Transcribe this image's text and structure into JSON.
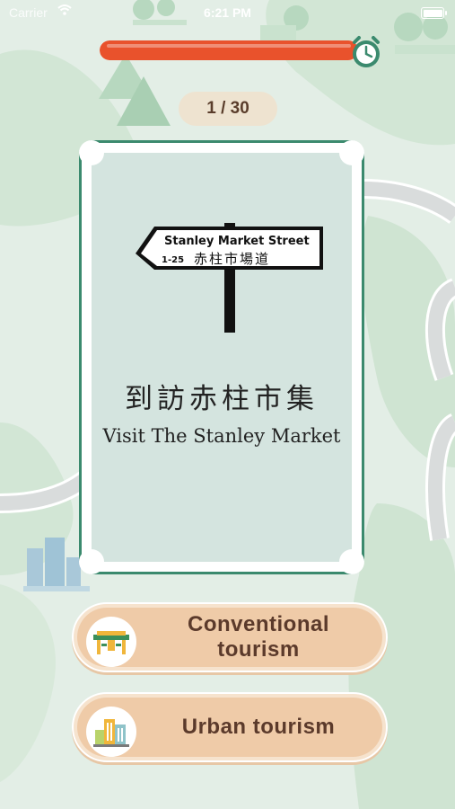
{
  "status_bar": {
    "carrier": "Carrier",
    "time": "6:21 PM"
  },
  "timer": {
    "remaining_fraction": 0.96,
    "fill_color": "#e9522c",
    "icon": "alarm-clock-icon"
  },
  "counter": {
    "text": "1 / 30",
    "current": 1,
    "total": 30
  },
  "card": {
    "sign": {
      "street_en": "Stanley Market Street",
      "numbers": "1-25",
      "street_cn": "赤柱市場道"
    },
    "title_cn": "到訪赤柱市集",
    "title_en": "Visit The Stanley Market"
  },
  "choices": [
    {
      "label": "Conventional tourism",
      "icon": "gateway-arch-icon"
    },
    {
      "label": "Urban tourism",
      "icon": "city-buildings-icon"
    }
  ],
  "colors": {
    "accent_red": "#e9522c",
    "card_border": "#3b8a6e",
    "button_fill": "#efcba8",
    "button_text": "#5b3a2b"
  }
}
